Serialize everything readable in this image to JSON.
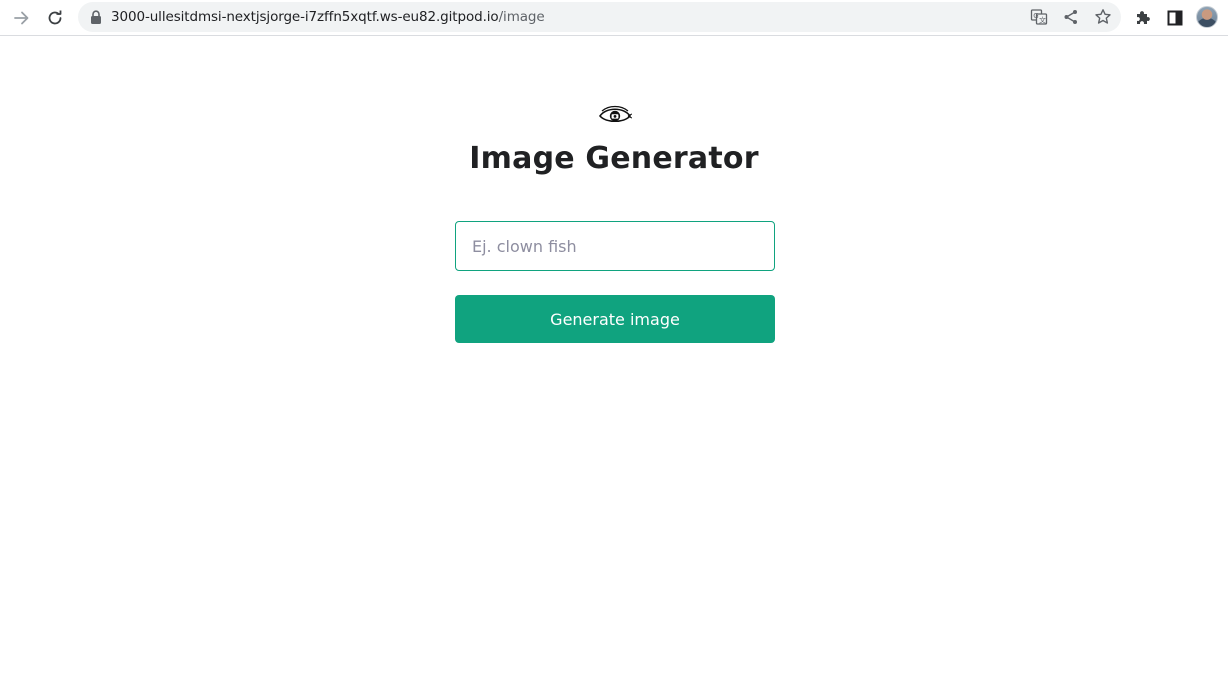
{
  "browser": {
    "url_host": "3000-ullesitdmsi-nextjsjorge-i7zffn5xqtf.ws-eu82.gitpod.io",
    "url_path": "/image",
    "icons": {
      "forward": "arrow-forward-icon",
      "reload": "reload-icon",
      "lock": "lock-icon",
      "translate": "translate-icon",
      "share": "share-icon",
      "bookmark": "star-icon",
      "extensions": "puzzle-icon",
      "side_panel": "side-panel-icon",
      "profile": "avatar"
    }
  },
  "page": {
    "logo_icon": "eye-icon",
    "title": "Image Generator",
    "prompt": {
      "value": "",
      "placeholder": "Ej. clown fish"
    },
    "button_label": "Generate image"
  },
  "colors": {
    "accent": "#10a37f",
    "title": "#202123",
    "placeholder": "#8e8ea0",
    "omnibox_bg": "#f1f3f4"
  }
}
